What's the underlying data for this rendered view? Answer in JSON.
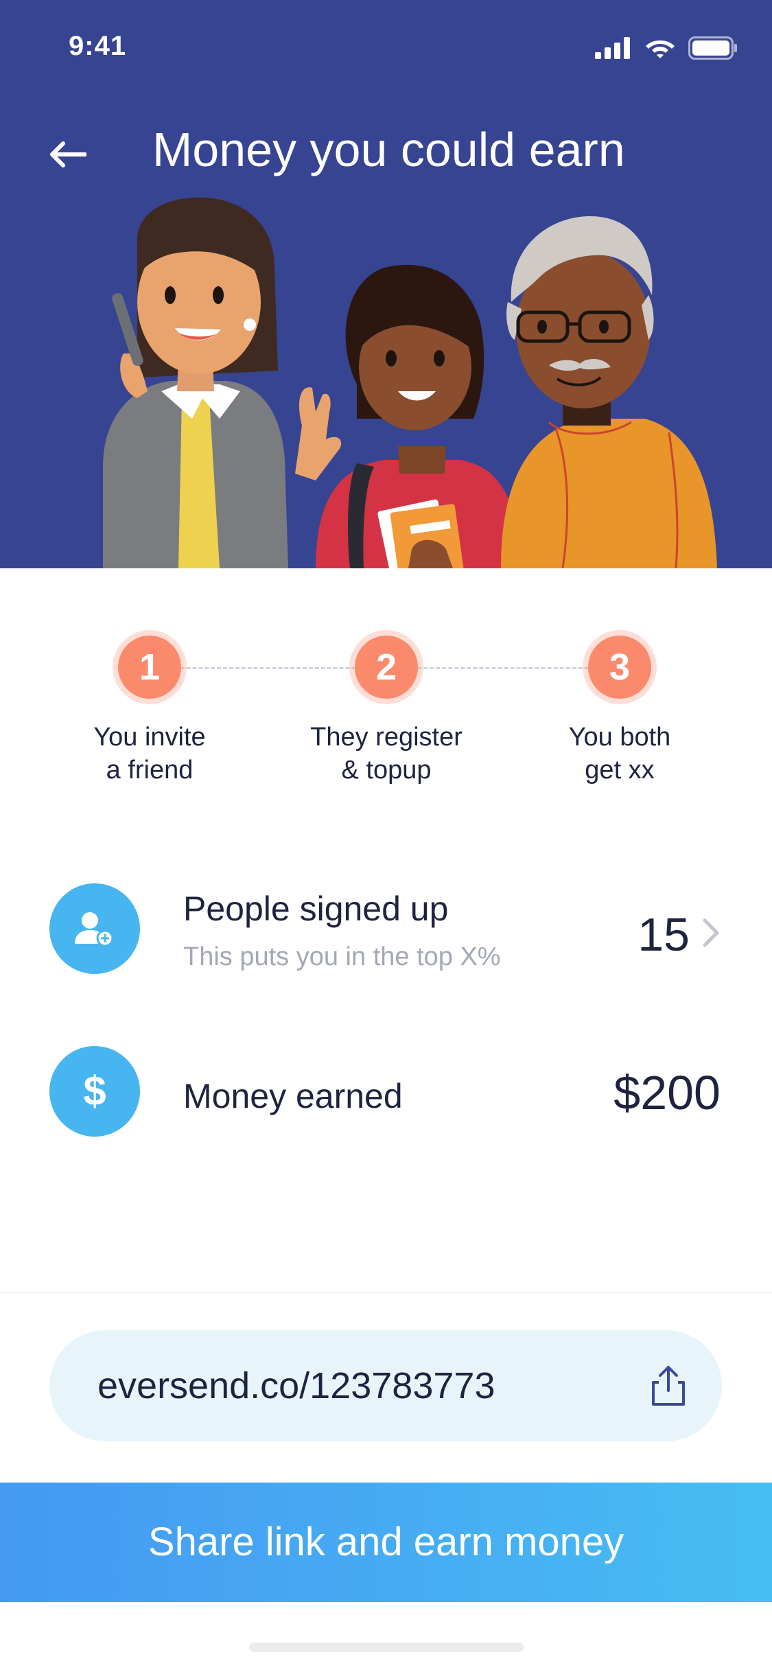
{
  "status_bar": {
    "time": "9:41"
  },
  "header": {
    "title": "Money you could earn"
  },
  "steps": [
    {
      "number": "1",
      "label": "You invite\na friend"
    },
    {
      "number": "2",
      "label": "They register\n& topup"
    },
    {
      "number": "3",
      "label": "You both\nget xx"
    }
  ],
  "stats": {
    "signups": {
      "title": "People signed up",
      "subtitle": "This puts you in the top X%",
      "value": "15",
      "icon": "add-user-icon"
    },
    "earned": {
      "title": "Money earned",
      "value": "$200",
      "icon": "dollar-icon"
    }
  },
  "referral": {
    "link": "eversend.co/123783773"
  },
  "cta": {
    "label": "Share link and earn money"
  },
  "colors": {
    "header_bg": "#374491",
    "step_accent": "#fb8a6d",
    "icon_circle": "#47b5ef",
    "cta_gradient_start": "#4599f3",
    "cta_gradient_end": "#47bdf1",
    "link_bg": "#e7f5fb"
  }
}
